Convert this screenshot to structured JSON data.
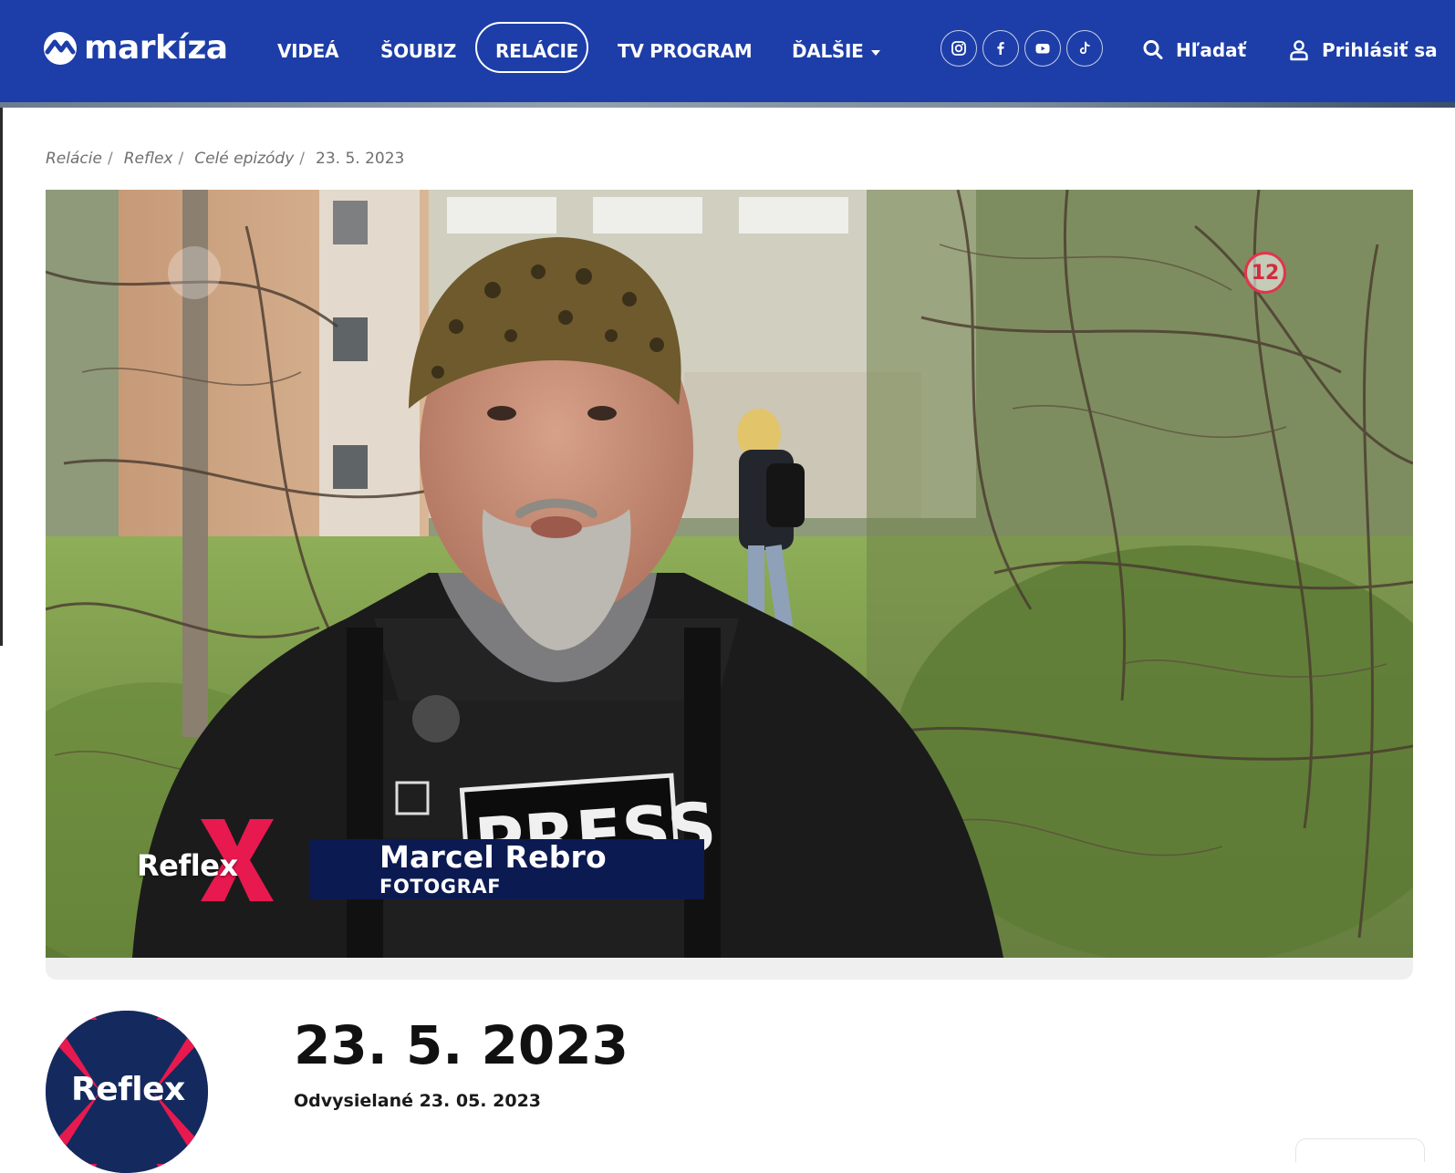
{
  "header": {
    "logo_text": "markíza",
    "nav": [
      {
        "label": "VIDEÁ",
        "active": false
      },
      {
        "label": "ŠOUBIZ",
        "active": false
      },
      {
        "label": "RELÁCIE",
        "active": true
      },
      {
        "label": "TV PROGRAM",
        "active": false
      },
      {
        "label": "ĎALŠIE",
        "active": false,
        "dropdown": true
      }
    ],
    "social": [
      "instagram-icon",
      "facebook-icon",
      "youtube-icon",
      "tiktok-icon"
    ],
    "search_label": "Hľadať",
    "login_label": "Prihlásiť sa"
  },
  "breadcrumb": {
    "items": [
      "Relácie",
      "Reflex",
      "Celé epizódy"
    ],
    "current": "23. 5. 2023"
  },
  "player": {
    "show_name": "Reflex",
    "lower_third_name": "Marcel Rebro",
    "lower_third_role": "FOTOGRAF",
    "age_rating": "12",
    "vest_text": "PRESS"
  },
  "episode": {
    "show_logo_text": "Reflex",
    "title": "23. 5. 2023",
    "aired": "Odvysielané 23. 05. 2023"
  },
  "colors": {
    "header_bg": "#1d3ea8",
    "brand_pink": "#e8194f",
    "lower_third_bg": "#0c1a52",
    "text": "#111111"
  }
}
